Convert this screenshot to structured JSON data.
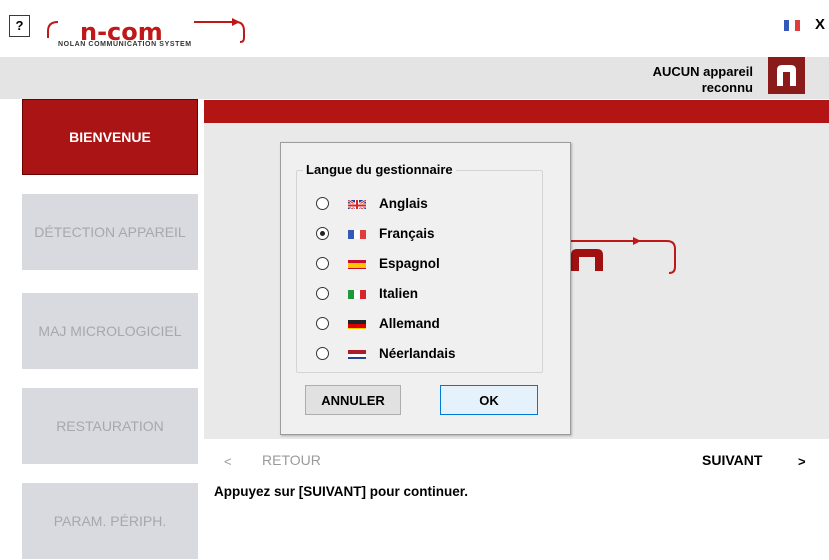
{
  "toolbar": {
    "help_label": "?",
    "close_label": "X",
    "logo_text": "n-com",
    "logo_tagline": "NOLAN COMMUNICATION SYSTEM"
  },
  "status": {
    "line1": "AUCUN appareil",
    "line2": "reconnu"
  },
  "sidebar": {
    "items": [
      {
        "label": "BIENVENUE",
        "active": true
      },
      {
        "label": "DÉTECTION APPAREIL",
        "active": false
      },
      {
        "label": "MAJ MICROLOGICIEL",
        "active": false
      },
      {
        "label": "RESTAURATION",
        "active": false
      },
      {
        "label": "PARAM. PÉRIPH.",
        "active": false
      }
    ]
  },
  "navigation": {
    "back_arrow": "<",
    "back_label": "RETOUR",
    "next_label": "SUIVANT",
    "next_arrow": ">",
    "hint": "Appuyez sur [SUIVANT] pour continuer."
  },
  "dialog": {
    "group_title": "Langue du gestionnaire",
    "languages": [
      {
        "label": "Anglais",
        "flag": "uk-flag",
        "selected": false
      },
      {
        "label": "Français",
        "flag": "france-flag",
        "selected": true
      },
      {
        "label": "Espagnol",
        "flag": "spain-flag",
        "selected": false
      },
      {
        "label": "Italien",
        "flag": "italy-flag",
        "selected": false
      },
      {
        "label": "Allemand",
        "flag": "germany-flag",
        "selected": false
      },
      {
        "label": "Néerlandais",
        "flag": "netherlands-flag",
        "selected": false
      }
    ],
    "cancel_label": "ANNULER",
    "ok_label": "OK"
  },
  "colors": {
    "brand_red": "#b31515",
    "sidebar_inactive": "#d9d9e0",
    "ok_border": "#0078d7"
  }
}
